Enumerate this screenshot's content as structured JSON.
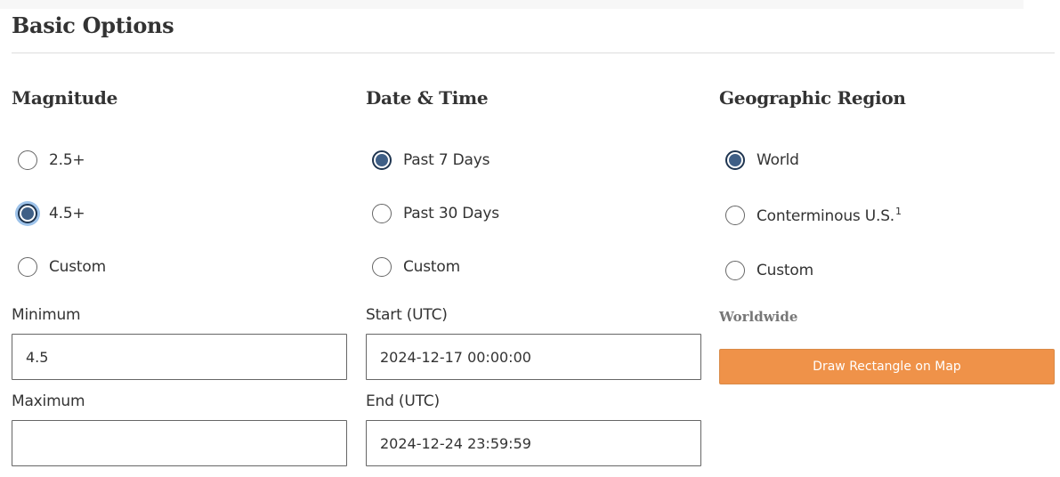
{
  "section": {
    "title": "Basic Options"
  },
  "magnitude": {
    "heading": "Magnitude",
    "options": [
      {
        "label": "2.5+",
        "checked": false
      },
      {
        "label": "4.5+",
        "checked": true
      },
      {
        "label": "Custom",
        "checked": false
      }
    ],
    "minimum_label": "Minimum",
    "minimum_value": "4.5",
    "maximum_label": "Maximum",
    "maximum_value": ""
  },
  "datetime": {
    "heading": "Date & Time",
    "options": [
      {
        "label": "Past 7 Days",
        "checked": true
      },
      {
        "label": "Past 30 Days",
        "checked": false
      },
      {
        "label": "Custom",
        "checked": false
      }
    ],
    "start_label": "Start (UTC)",
    "start_value": "2024-12-17 00:00:00",
    "end_label": "End (UTC)",
    "end_value": "2024-12-24 23:59:59"
  },
  "region": {
    "heading": "Geographic Region",
    "options": [
      {
        "label": "World",
        "checked": true
      },
      {
        "label": "Conterminous U.S.",
        "footnote": "1",
        "checked": false
      },
      {
        "label": "Custom",
        "checked": false
      }
    ],
    "current_label": "Worldwide",
    "draw_button_label": "Draw Rectangle on Map"
  },
  "colors": {
    "radio_selected": "#3f5f86",
    "button_orange": "#ef9249",
    "focus_ring": "#9ec3ea"
  }
}
